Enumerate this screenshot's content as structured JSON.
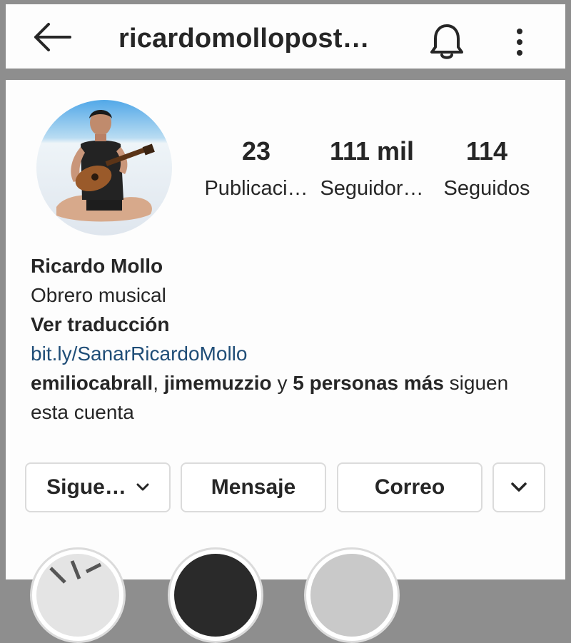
{
  "header": {
    "username": "ricardomollopost…",
    "icons": [
      "back-arrow-icon",
      "bell-icon",
      "more-vertical-icon"
    ]
  },
  "profile": {
    "stats": [
      {
        "value": "23",
        "label": "Publicaci…"
      },
      {
        "value": "111 mil",
        "label": "Seguidor…"
      },
      {
        "value": "114",
        "label": "Seguidos"
      }
    ]
  },
  "bio": {
    "name": "Ricardo Mollo",
    "description": "Obrero musical",
    "translate": "Ver traducción",
    "link": "bit.ly/SanarRicardoMollo",
    "followed_by": {
      "user1": "emiliocabrall",
      "sep1": ",",
      "user2": "jimemuzzio",
      "sep2": " y ",
      "others": "5 personas más",
      "tail1": " siguen",
      "tail2": "esta cuenta"
    }
  },
  "actions": {
    "following": "Sigue…",
    "message": "Mensaje",
    "email": "Correo"
  },
  "colors": {
    "link": "#1f4d77",
    "border": "#dbdbdb",
    "text": "#262626",
    "frame": "#8e8e8e"
  }
}
